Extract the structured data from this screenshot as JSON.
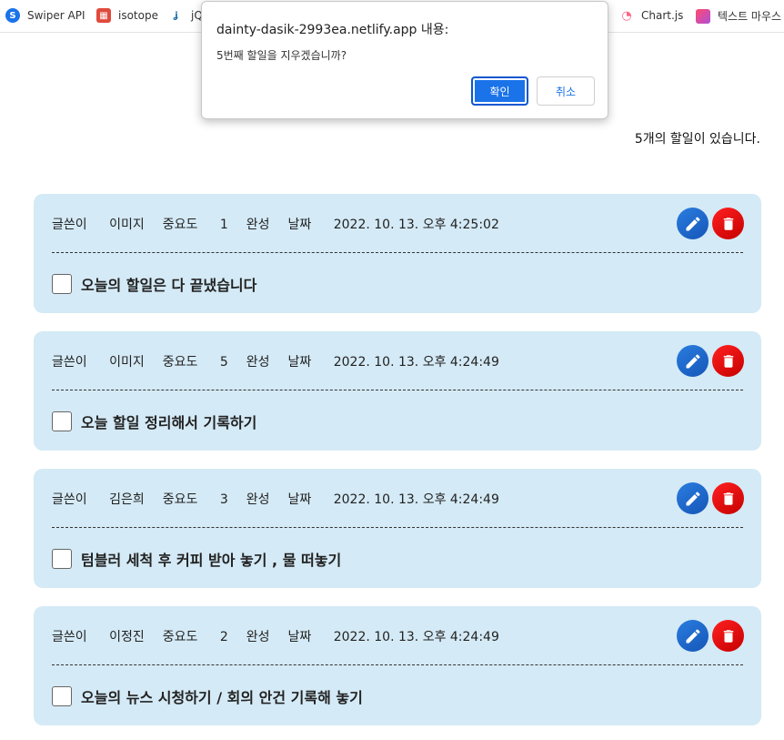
{
  "bookmarks": [
    {
      "label": "Swiper API",
      "icon": "swiper-icon"
    },
    {
      "label": "isotope",
      "icon": "isotope-icon"
    },
    {
      "label": "jQ",
      "icon": "jquery-icon"
    },
    {
      "label": "Chart.js",
      "icon": "chartjs-icon"
    },
    {
      "label": "텍스트 마우스",
      "icon": "bookmark-gradient-icon"
    }
  ],
  "dialog": {
    "title": "dainty-dasik-2993ea.netlify.app 내용:",
    "message": "5번째 할일을 지우겠습니까?",
    "ok_label": "확인",
    "cancel_label": "취소"
  },
  "summary": "5개의 할일이 있습니다.",
  "labels": {
    "author": "글쓴이",
    "importance": "중요도",
    "status": "완성",
    "date": "날짜"
  },
  "todos": [
    {
      "author": "이미지",
      "importance": "1",
      "date": "2022. 10. 13. 오후 4:25:02",
      "text": "오늘의 할일은 다 끝냈습니다"
    },
    {
      "author": "이미지",
      "importance": "5",
      "date": "2022. 10. 13. 오후 4:24:49",
      "text": "오늘 할일 정리해서 기록하기"
    },
    {
      "author": "김은희",
      "importance": "3",
      "date": "2022. 10. 13. 오후 4:24:49",
      "text": "텀블러 세척 후 커피 받아 놓기 , 물 떠놓기"
    },
    {
      "author": "이정진",
      "importance": "2",
      "date": "2022. 10. 13. 오후 4:24:49",
      "text": "오늘의 뉴스 시청하기 / 회의 안건 기록해 놓기"
    }
  ],
  "colors": {
    "card_bg": "#d4eaf6",
    "edit_button": "#1a73e8",
    "delete_button": "#e80e0e"
  }
}
